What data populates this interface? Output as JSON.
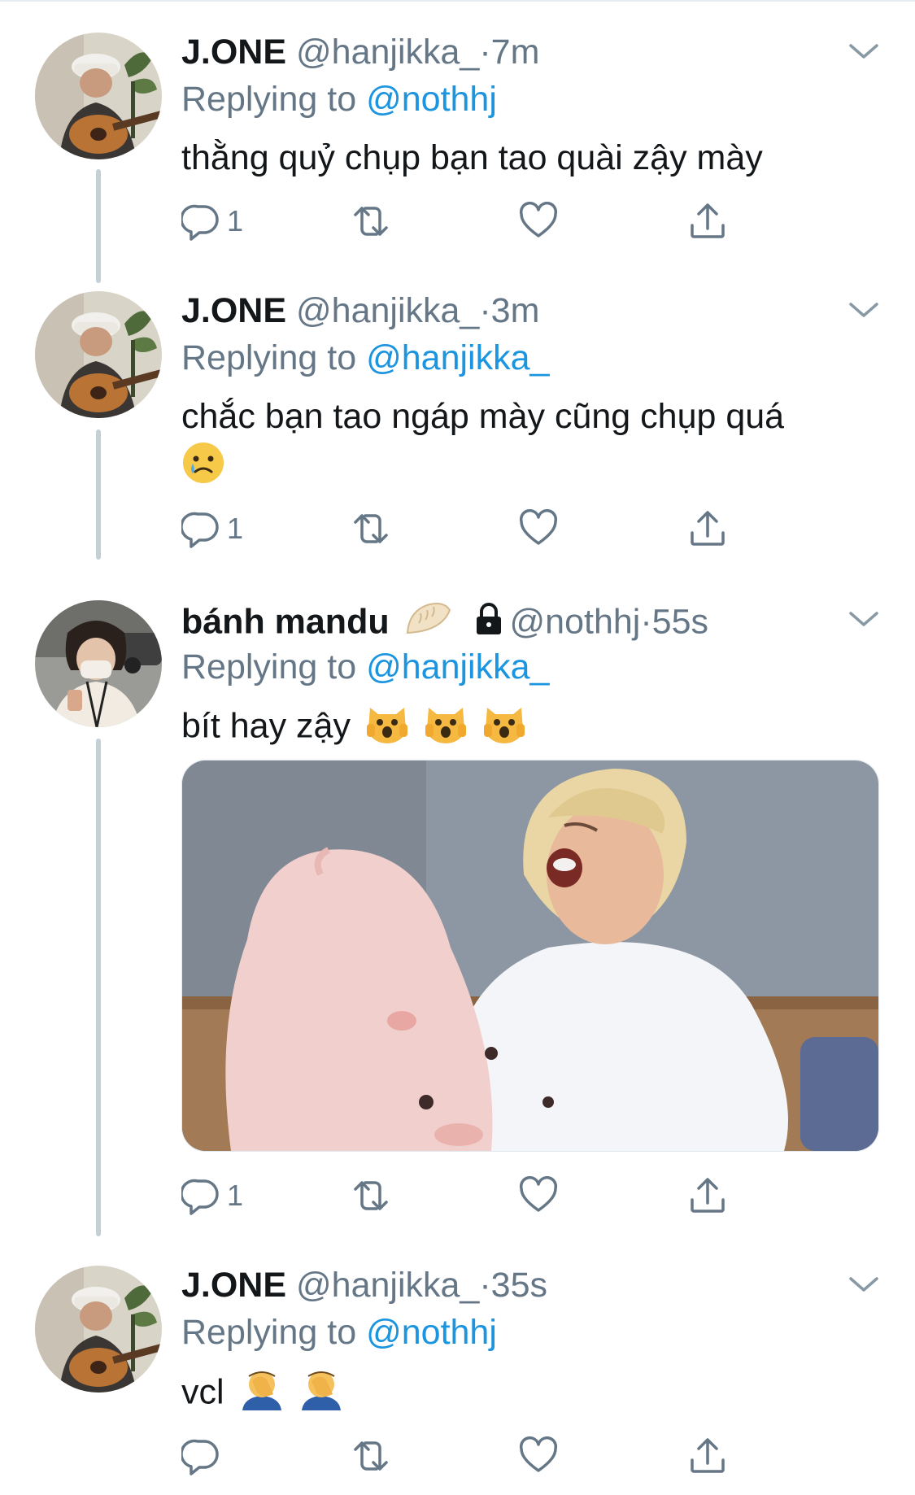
{
  "tweets": [
    {
      "name": "J.ONE",
      "handle": "@hanjikka_",
      "dot": "·",
      "time": "7m",
      "replying_prefix": "Replying to",
      "replying_to": "@nothhj",
      "text": "thằng quỷ chụp bạn tao quài zậy mày",
      "reply_count": "1",
      "avatar": "guitar-player-avatar"
    },
    {
      "name": "J.ONE",
      "handle": "@hanjikka_",
      "dot": "·",
      "time": "3m",
      "replying_prefix": "Replying to",
      "replying_to": "@hanjikka_",
      "text": "chắc bạn tao ngáp mày cũng chụp quá",
      "emojis": [
        "crying-face-emoji"
      ],
      "reply_count": "1",
      "avatar": "guitar-player-avatar"
    },
    {
      "name": "bánh mandu",
      "name_emoji": "dumpling-emoji",
      "protected": true,
      "handle": "@nothhj",
      "dot": "·",
      "time": "55s",
      "replying_prefix": "Replying to",
      "replying_to": "@hanjikka_",
      "text": "bít hay zậy",
      "emojis": [
        "weary-cat-emoji",
        "weary-cat-emoji",
        "weary-cat-emoji"
      ],
      "media": "yawning-person-photo",
      "reply_count": "1",
      "avatar": "masked-person-avatar"
    },
    {
      "name": "J.ONE",
      "handle": "@hanjikka_",
      "dot": "·",
      "time": "35s",
      "replying_prefix": "Replying to",
      "replying_to": "@nothhj",
      "text": "vcl",
      "emojis": [
        "facepalm-emoji",
        "facepalm-emoji"
      ],
      "reply_count": "",
      "avatar": "guitar-player-avatar"
    }
  ],
  "colors": {
    "link": "#1b95e0",
    "secondary_text": "#657786",
    "primary_text": "#14171a",
    "thread_line": "#c4cfd6"
  }
}
